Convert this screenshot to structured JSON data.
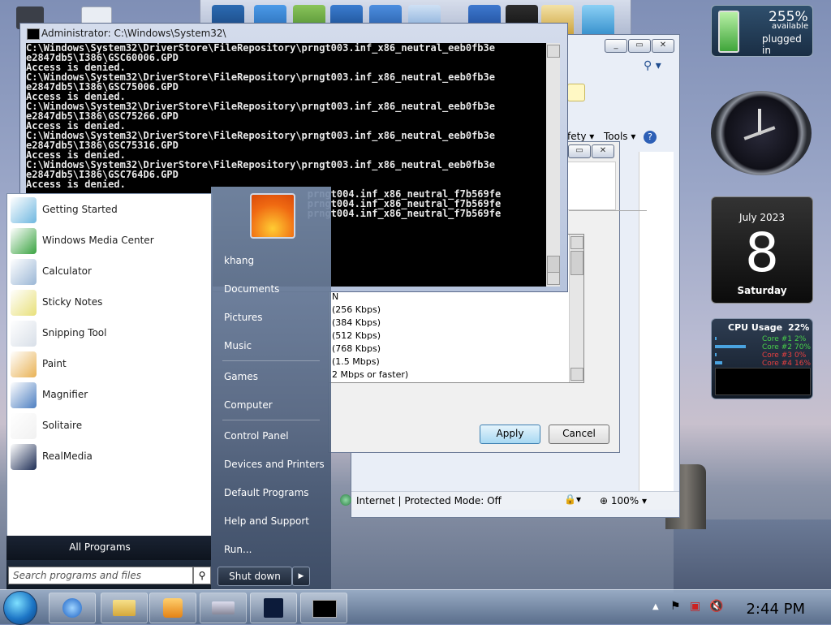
{
  "cmd": {
    "title": "Administrator: C:\\Windows\\System32\\",
    "lines": [
      "C:\\Windows\\System32\\DriverStore\\FileRepository\\prngt003.inf_x86_neutral_eeb0fb3e",
      "e2847db5\\I386\\GSC60006.GPD",
      "Access is denied.",
      "C:\\Windows\\System32\\DriverStore\\FileRepository\\prngt003.inf_x86_neutral_eeb0fb3e",
      "e2847db5\\I386\\GSC75006.GPD",
      "Access is denied.",
      "C:\\Windows\\System32\\DriverStore\\FileRepository\\prngt003.inf_x86_neutral_eeb0fb3e",
      "e2847db5\\I386\\GSC75266.GPD",
      "Access is denied.",
      "C:\\Windows\\System32\\DriverStore\\FileRepository\\prngt003.inf_x86_neutral_eeb0fb3e",
      "e2847db5\\I386\\GSC75316.GPD",
      "Access is denied.",
      "C:\\Windows\\System32\\DriverStore\\FileRepository\\prngt003.inf_x86_neutral_eeb0fb3e",
      "e2847db5\\I386\\GSC764D6.GPD",
      "Access is denied.",
      "                                                prngt004.inf_x86_neutral_f7b569fe",
      "",
      "",
      "                                                prngt004.inf_x86_neutral_f7b569fe",
      "",
      "",
      "                                                prngt004.inf_x86_neutral_f7b569fe"
    ]
  },
  "explorer": {
    "toolbar_safety": "fety",
    "toolbar_tools": "Tools",
    "status_zone": "Internet | Protected Mode: Off",
    "zoom": "100%"
  },
  "dialog": {
    "list_items": [
      "(256 Kbps)",
      "(384 Kbps)",
      "(512 Kbps)",
      "(768 Kbps)",
      "(1.5 Mbps)",
      "2 Mbps or faster)"
    ],
    "partial_top": "N",
    "apply_label": "Apply",
    "cancel_label": "Cancel"
  },
  "battery": {
    "percent": "255%",
    "line1": "available",
    "line2": "plugged in"
  },
  "calendar": {
    "month_year": "July 2023",
    "day": "8",
    "weekday": "Saturday"
  },
  "cpu": {
    "title": "CPU Usage",
    "total": "22%",
    "cores": [
      {
        "label": "Core #1",
        "value": "2%",
        "color": "#49d14b"
      },
      {
        "label": "Core #2",
        "value": "70%",
        "color": "#49d14b"
      },
      {
        "label": "Core #3",
        "value": "0%",
        "color": "#e84040"
      },
      {
        "label": "Core #4",
        "value": "16%",
        "color": "#e84040"
      }
    ]
  },
  "startmenu": {
    "programs": [
      {
        "label": "Getting Started",
        "icon": "getting-started-icon",
        "color": "#6fb7e0"
      },
      {
        "label": "Windows Media Center",
        "icon": "media-center-icon",
        "color": "#3aa341"
      },
      {
        "label": "Calculator",
        "icon": "calculator-icon",
        "color": "#9bb7d6"
      },
      {
        "label": "Sticky Notes",
        "icon": "sticky-notes-icon",
        "color": "#e8e07a"
      },
      {
        "label": "Snipping Tool",
        "icon": "snipping-tool-icon",
        "color": "#d8dfe8"
      },
      {
        "label": "Paint",
        "icon": "paint-icon",
        "color": "#e9b255"
      },
      {
        "label": "Magnifier",
        "icon": "magnifier-icon",
        "color": "#4d7fc1"
      },
      {
        "label": "Solitaire",
        "icon": "solitaire-icon",
        "color": "#f1f1f1"
      },
      {
        "label": "RealMedia",
        "icon": "realmedia-icon",
        "color": "#1d2d55"
      }
    ],
    "all_programs": "All Programs",
    "search_placeholder": "Search programs and files",
    "right_items": [
      "khang",
      "Documents",
      "Pictures",
      "Music",
      "Games",
      "Computer",
      "Control Panel",
      "Devices and Printers",
      "Default Programs",
      "Help and Support",
      "Run..."
    ],
    "shutdown_label": "Shut down"
  },
  "taskbar": {
    "clock": "2:44 PM"
  }
}
